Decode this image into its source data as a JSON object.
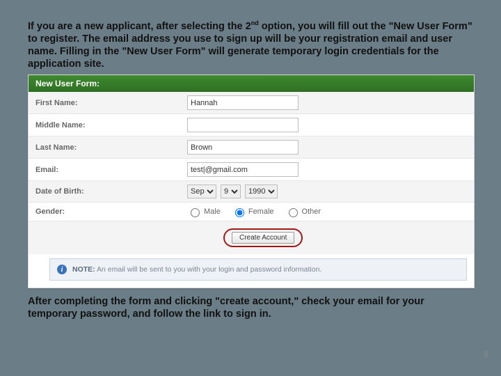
{
  "intro_html": "If you are a new applicant, after selecting the 2<sup>nd</sup> option, you will fill out the \"New User Form\" to register. The email address you use to sign up will be your registration email and user name. Filling in the \"New User Form\" will generate temporary login credentials for the application site.",
  "panel_title": "New User Form:",
  "fields": {
    "first_name": {
      "label": "First Name:",
      "value": "Hannah"
    },
    "middle_name": {
      "label": "Middle Name:",
      "value": ""
    },
    "last_name": {
      "label": "Last Name:",
      "value": "Brown"
    },
    "email": {
      "label": "Email:",
      "value": "test|@gmail.com"
    },
    "dob": {
      "label": "Date of Birth:",
      "month": "Sep",
      "day": "9",
      "year": "1990"
    },
    "gender": {
      "label": "Gender:",
      "options": [
        "Male",
        "Female",
        "Other"
      ],
      "selected": "Female"
    }
  },
  "create_button": "Create Account",
  "note_label": "NOTE:",
  "note_text": "An email will be sent to you with your login and password information.",
  "outro": "After completing the form and clicking \"create account,\" check your email for your temporary password, and follow the link to sign in.",
  "page_number": "8"
}
